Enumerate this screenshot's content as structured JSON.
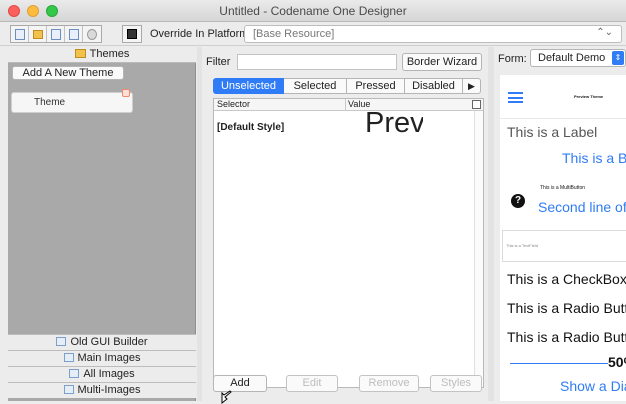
{
  "window": {
    "title": "Untitled - Codename One Designer"
  },
  "toolbar": {
    "icons": [
      "new-file-icon",
      "open-folder-icon",
      "save-icon",
      "edit-icon",
      "settings-icon",
      "preview-icon"
    ],
    "override_label": "Override In Platform:",
    "platform_value": "[Base Resource]",
    "platform_chevron": "⌃⌄"
  },
  "left_panel": {
    "themes_tab": "Themes",
    "add_theme_button": "Add A New Theme",
    "theme_item": "Theme",
    "bottom_tabs": [
      {
        "label": "Old GUI Builder",
        "icon": "gui-builder-icon"
      },
      {
        "label": "Main Images",
        "icon": "images-icon"
      },
      {
        "label": "All Images",
        "icon": "images-icon"
      },
      {
        "label": "Multi-Images",
        "icon": "images-icon"
      }
    ]
  },
  "center_panel": {
    "filter_label": "Filter",
    "filter_value": "",
    "border_wizard": "Border Wizard",
    "tabs": [
      "Unselected",
      "Selected",
      "Pressed",
      "Disabled"
    ],
    "tabs_more": "▶",
    "active_tab": "Unselected",
    "table": {
      "columns": [
        "Selector",
        "Value"
      ],
      "rows": [
        {
          "selector": "[Default Style]",
          "value": "Preview"
        }
      ]
    },
    "buttons": [
      {
        "label": "Add",
        "enabled": true
      },
      {
        "label": "Edit",
        "enabled": false
      },
      {
        "label": "Remove",
        "enabled": false
      },
      {
        "label": "Styles",
        "enabled": false
      }
    ]
  },
  "preview_panel": {
    "form_label": "Form:",
    "form_value": "Default Demo",
    "preview": {
      "toolbar_title": "Preview Theme",
      "label": "This is a Label",
      "button": "This is a Button",
      "multibutton_line1": "This is a MultiButton",
      "multibutton_line2": "Second line of text",
      "textfield": "This is a TextField",
      "checkbox": "This is a CheckBox",
      "radio1": "This is a Radio Button",
      "radio2": "This is a Radio Button",
      "slider_value": "50%",
      "dialog_button": "Show a Dialog"
    }
  },
  "colors": {
    "accent": "#2f7cf6",
    "panel_gray": "#a9a9a9",
    "window_bg": "#ececec"
  }
}
